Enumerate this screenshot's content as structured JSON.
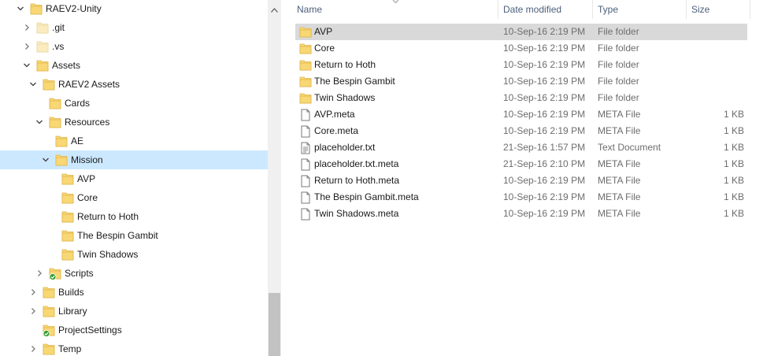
{
  "nav": {
    "items": [
      {
        "label": "RAEV2-Unity",
        "chevron": "down",
        "icon": "folder",
        "indent": 0
      },
      {
        "label": ".git",
        "chevron": "right",
        "icon": "folder-faded",
        "indent": 1
      },
      {
        "label": ".vs",
        "chevron": "right",
        "icon": "folder-faded",
        "indent": 1
      },
      {
        "label": "Assets",
        "chevron": "down",
        "icon": "folder",
        "indent": 1
      },
      {
        "label": "RAEV2 Assets",
        "chevron": "down",
        "icon": "folder",
        "indent": 2
      },
      {
        "label": "Cards",
        "chevron": "none",
        "icon": "folder",
        "indent": 3
      },
      {
        "label": "Resources",
        "chevron": "down",
        "icon": "folder",
        "indent": 3
      },
      {
        "label": "AE",
        "chevron": "none",
        "icon": "folder",
        "indent": 4
      },
      {
        "label": "Mission",
        "chevron": "down",
        "icon": "folder",
        "indent": 4,
        "selected": true
      },
      {
        "label": "AVP",
        "chevron": "none",
        "icon": "folder",
        "indent": 5
      },
      {
        "label": "Core",
        "chevron": "none",
        "icon": "folder",
        "indent": 5
      },
      {
        "label": "Return to Hoth",
        "chevron": "none",
        "icon": "folder",
        "indent": 5
      },
      {
        "label": "The Bespin Gambit",
        "chevron": "none",
        "icon": "folder",
        "indent": 5
      },
      {
        "label": "Twin Shadows",
        "chevron": "none",
        "icon": "folder",
        "indent": 5
      },
      {
        "label": "Scripts",
        "chevron": "right",
        "icon": "folder-check",
        "indent": 3
      },
      {
        "label": "Builds",
        "chevron": "right",
        "icon": "folder",
        "indent": 2
      },
      {
        "label": "Library",
        "chevron": "right",
        "icon": "folder",
        "indent": 2
      },
      {
        "label": "ProjectSettings",
        "chevron": "none",
        "icon": "folder-check",
        "indent": 2
      },
      {
        "label": "Temp",
        "chevron": "right",
        "icon": "folder",
        "indent": 2
      }
    ]
  },
  "list": {
    "columns": {
      "name": "Name",
      "date": "Date modified",
      "type": "Type",
      "size": "Size"
    },
    "rows": [
      {
        "name": "AVP",
        "date": "10-Sep-16 2:19 PM",
        "type": "File folder",
        "size": "",
        "icon": "folder",
        "selected": true
      },
      {
        "name": "Core",
        "date": "10-Sep-16 2:19 PM",
        "type": "File folder",
        "size": "",
        "icon": "folder"
      },
      {
        "name": "Return to Hoth",
        "date": "10-Sep-16 2:19 PM",
        "type": "File folder",
        "size": "",
        "icon": "folder"
      },
      {
        "name": "The Bespin Gambit",
        "date": "10-Sep-16 2:19 PM",
        "type": "File folder",
        "size": "",
        "icon": "folder"
      },
      {
        "name": "Twin Shadows",
        "date": "10-Sep-16 2:19 PM",
        "type": "File folder",
        "size": "",
        "icon": "folder"
      },
      {
        "name": "AVP.meta",
        "date": "10-Sep-16 2:19 PM",
        "type": "META File",
        "size": "1 KB",
        "icon": "file"
      },
      {
        "name": "Core.meta",
        "date": "10-Sep-16 2:19 PM",
        "type": "META File",
        "size": "1 KB",
        "icon": "file"
      },
      {
        "name": "placeholder.txt",
        "date": "21-Sep-16 1:57 PM",
        "type": "Text Document",
        "size": "1 KB",
        "icon": "text-file"
      },
      {
        "name": "placeholder.txt.meta",
        "date": "21-Sep-16 2:10 PM",
        "type": "META File",
        "size": "1 KB",
        "icon": "file"
      },
      {
        "name": "Return to Hoth.meta",
        "date": "10-Sep-16 2:19 PM",
        "type": "META File",
        "size": "1 KB",
        "icon": "file"
      },
      {
        "name": "The Bespin Gambit.meta",
        "date": "10-Sep-16 2:19 PM",
        "type": "META File",
        "size": "1 KB",
        "icon": "file"
      },
      {
        "name": "Twin Shadows.meta",
        "date": "10-Sep-16 2:19 PM",
        "type": "META File",
        "size": "1 KB",
        "icon": "file"
      }
    ]
  },
  "colors": {
    "folder": "#f8d775",
    "selection_nav": "#cce8ff",
    "selection_list": "#d9d9d9",
    "header_text": "#4c607a"
  }
}
